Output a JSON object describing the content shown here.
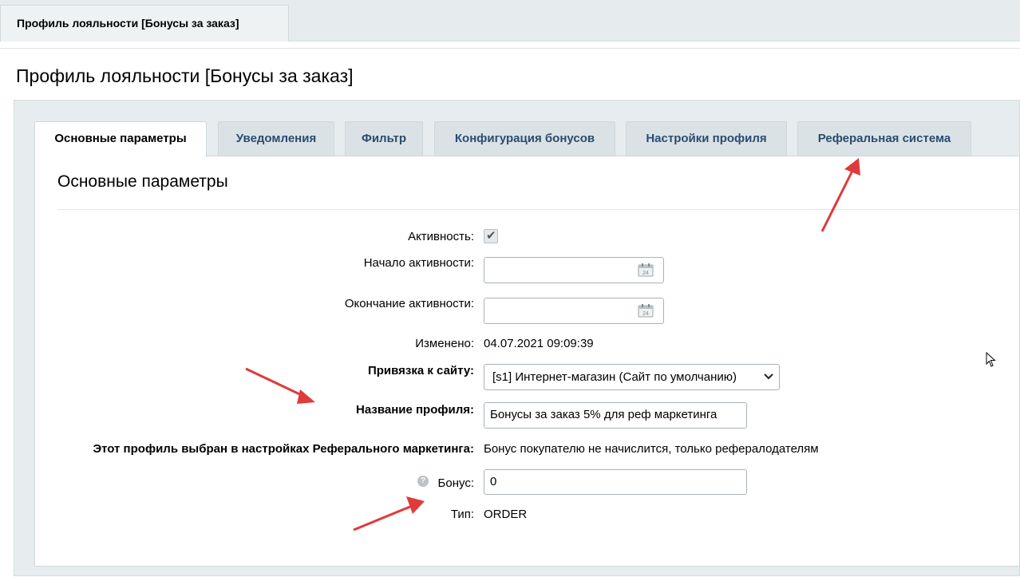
{
  "window": {
    "tab_label": "Профиль лояльности [Бонусы за заказ]"
  },
  "page": {
    "title": "Профиль лояльности [Бонусы за заказ]"
  },
  "tabs": [
    {
      "label": "Основные параметры",
      "active": true
    },
    {
      "label": "Уведомления",
      "active": false
    },
    {
      "label": "Фильтр",
      "active": false
    },
    {
      "label": "Конфигурация бонусов",
      "active": false
    },
    {
      "label": "Настройки профиля",
      "active": false
    },
    {
      "label": "Реферальная система",
      "active": false
    }
  ],
  "section": {
    "title": "Основные параметры"
  },
  "form": {
    "active": {
      "label": "Активность:",
      "checked": true
    },
    "start": {
      "label": "Начало активности:",
      "value": ""
    },
    "end": {
      "label": "Окончание активности:",
      "value": ""
    },
    "modified": {
      "label": "Изменено:",
      "value": "04.07.2021 09:09:39"
    },
    "site": {
      "label": "Привязка к сайту:",
      "value": "[s1] Интернет-магазин (Сайт по умолчанию)"
    },
    "name": {
      "label": "Название профиля:",
      "value": "Бонусы за заказ 5% для реф маркетинга"
    },
    "referral": {
      "label": "Этот профиль выбран в настройках Реферального маркетинга:",
      "value": "Бонус покупателю не начислится, только рефералодателям"
    },
    "bonus": {
      "label": "Бонус:",
      "value": "0"
    },
    "type": {
      "label": "Тип:",
      "value": "ORDER"
    }
  },
  "icons": {
    "calendar": "calendar-icon",
    "help": "help-icon",
    "chevron": "chevron-down-icon",
    "cursor": "mouse-cursor-icon"
  },
  "colors": {
    "tab_text": "#2b4c6f",
    "annotation_arrow": "#e03a3a",
    "panel_bg": "#e7edef"
  }
}
